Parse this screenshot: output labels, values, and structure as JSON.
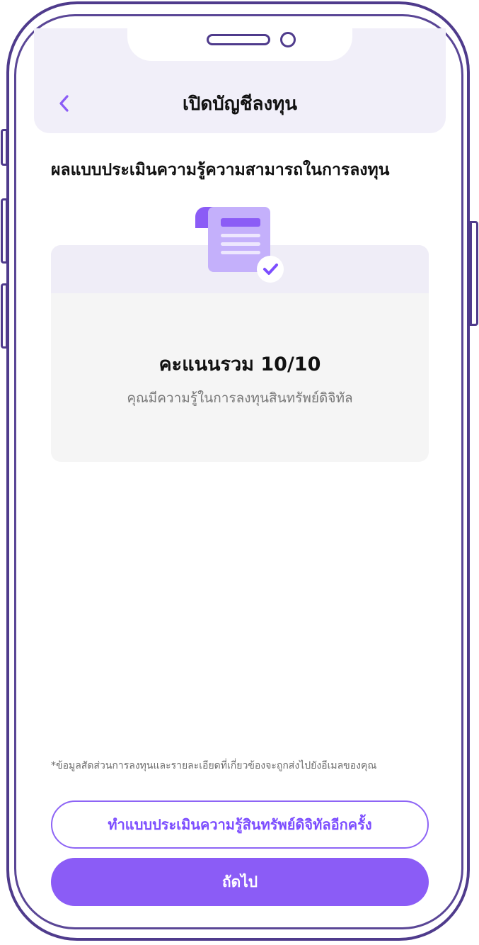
{
  "header": {
    "title": "เปิดบัญชีลงทุน",
    "back_icon": "chevron-left-icon"
  },
  "section": {
    "heading": "ผลแบบประเมินความรู้ความสามารถในการลงทุน"
  },
  "result": {
    "illustration_icon": "document-check-icon",
    "score_label": "คะแนนรวม 10/10",
    "description": "คุณมีความรู้ในการลงทุนสินทรัพย์ดิจิทัล"
  },
  "footnote": "*ข้อมูลสัดส่วนการลงทุนและรายละเอียดที่เกี่ยวข้องจะถูกส่งไปยังอีเมลของคุณ",
  "buttons": {
    "retake_label": "ทำแบบประเมินความรู้สินทรัพย์ดิจิทัลอีกครั้ง",
    "next_label": "ถัดไป"
  },
  "colors": {
    "accent": "#8b5cf6",
    "accent_text": "#7c4dff",
    "frame": "#4f3b8c",
    "header_bg": "#f1eff9",
    "card_bg": "#f5f5f5"
  }
}
